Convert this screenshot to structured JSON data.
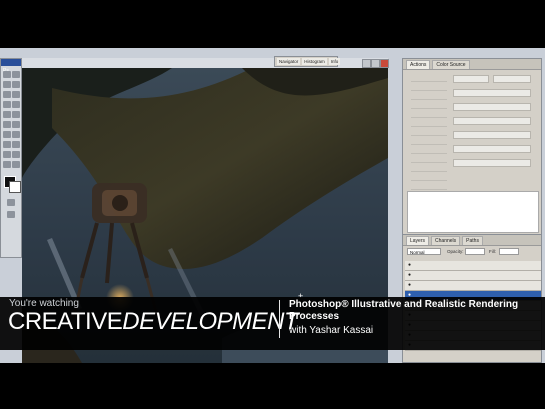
{
  "app": {
    "ps_logo": "Ps"
  },
  "tabs": {
    "navigator": "Navigator",
    "histogram": "Histogram",
    "info": "Info"
  },
  "actions_panel": {
    "tabs": [
      "Actions",
      "Color Source"
    ],
    "items": [
      "",
      "",
      "",
      "",
      "",
      "",
      "",
      "",
      "",
      "",
      "",
      "",
      ""
    ]
  },
  "layers_panel": {
    "tabs": [
      "Layers",
      "Channels",
      "Paths"
    ],
    "blend_mode": "Normal",
    "opacity_label": "Opacity:",
    "fill_label": "Fill:",
    "layers": [
      {
        "label": "",
        "selected": false
      },
      {
        "label": "",
        "selected": false
      },
      {
        "label": "",
        "selected": false
      },
      {
        "label": "",
        "selected": true
      },
      {
        "label": "",
        "selected": false
      },
      {
        "label": "",
        "selected": false
      },
      {
        "label": "",
        "selected": false
      },
      {
        "label": "",
        "selected": false
      },
      {
        "label": "",
        "selected": false
      }
    ]
  },
  "overlay": {
    "watching": "You're watching",
    "brand_part1": "CREATIVE",
    "brand_part2": "DEVELOPMENT",
    "course_title": "Photoshop® Illustrative and Realistic Rendering Processes",
    "author": "with Yashar Kassai"
  },
  "colors": {
    "overlay_bg": "#000000",
    "canvas_bg": "#2d3a47",
    "selected_layer": "#2e5fae"
  }
}
